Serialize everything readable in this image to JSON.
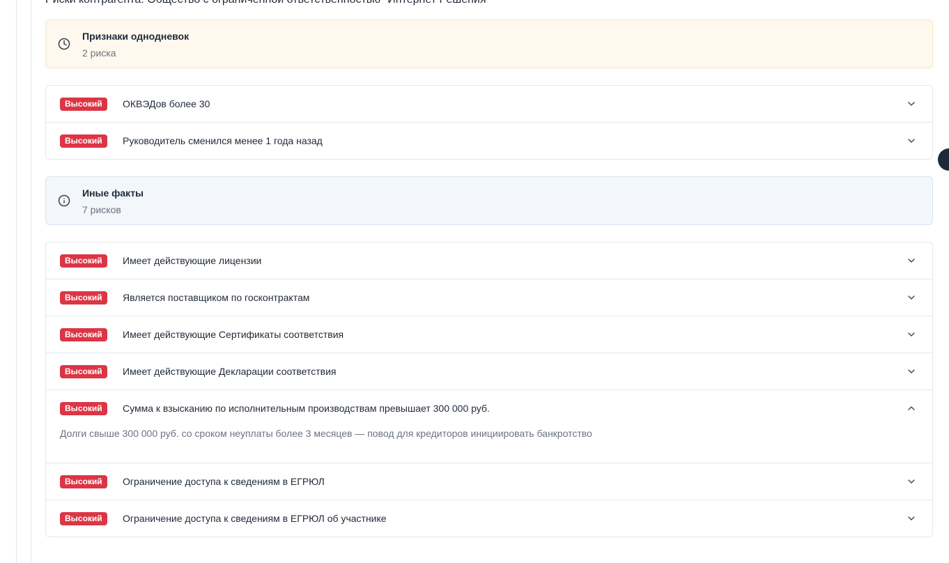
{
  "page": {
    "title": "Риски контрагента: Общество с ограниченной ответственностью \"Интернет Решения\""
  },
  "groups": [
    {
      "title": "Признаки однодневок",
      "count": "2 риска",
      "icon": "clock-icon",
      "color": "#fff8ee",
      "items": [
        {
          "badge": "Высокий",
          "label": "ОКВЭДов более 30"
        },
        {
          "badge": "Высокий",
          "label": "Руководитель сменился менее 1 года назад"
        }
      ]
    },
    {
      "title": "Иные факты",
      "count": "7 рисков",
      "icon": "info-icon",
      "color": "#f3f7fc",
      "items": [
        {
          "badge": "Высокий",
          "label": "Имеет действующие лицензии"
        },
        {
          "badge": "Высокий",
          "label": "Является поставщиком по госконтрактам"
        },
        {
          "badge": "Высокий",
          "label": "Имеет действующие Сертификаты соответствия"
        },
        {
          "badge": "Высокий",
          "label": "Имеет действующие Декларации соответствия"
        },
        {
          "badge": "Высокий",
          "label": "Сумма к взысканию по исполнительным производствам превышает 300 000 руб.",
          "description": "Долги свыше 300 000 руб. со сроком неуплаты более 3 месяцев — повод для кредиторов инициировать банкротство",
          "expanded": true
        },
        {
          "badge": "Высокий",
          "label": "Ограничение доступа к сведениям в ЕГРЮЛ"
        },
        {
          "badge": "Высокий",
          "label": "Ограничение доступа к сведениям в ЕГРЮЛ об участнике"
        }
      ]
    }
  ],
  "colors": {
    "badge_high": "#dc3545",
    "border": "#e5e7eb"
  }
}
